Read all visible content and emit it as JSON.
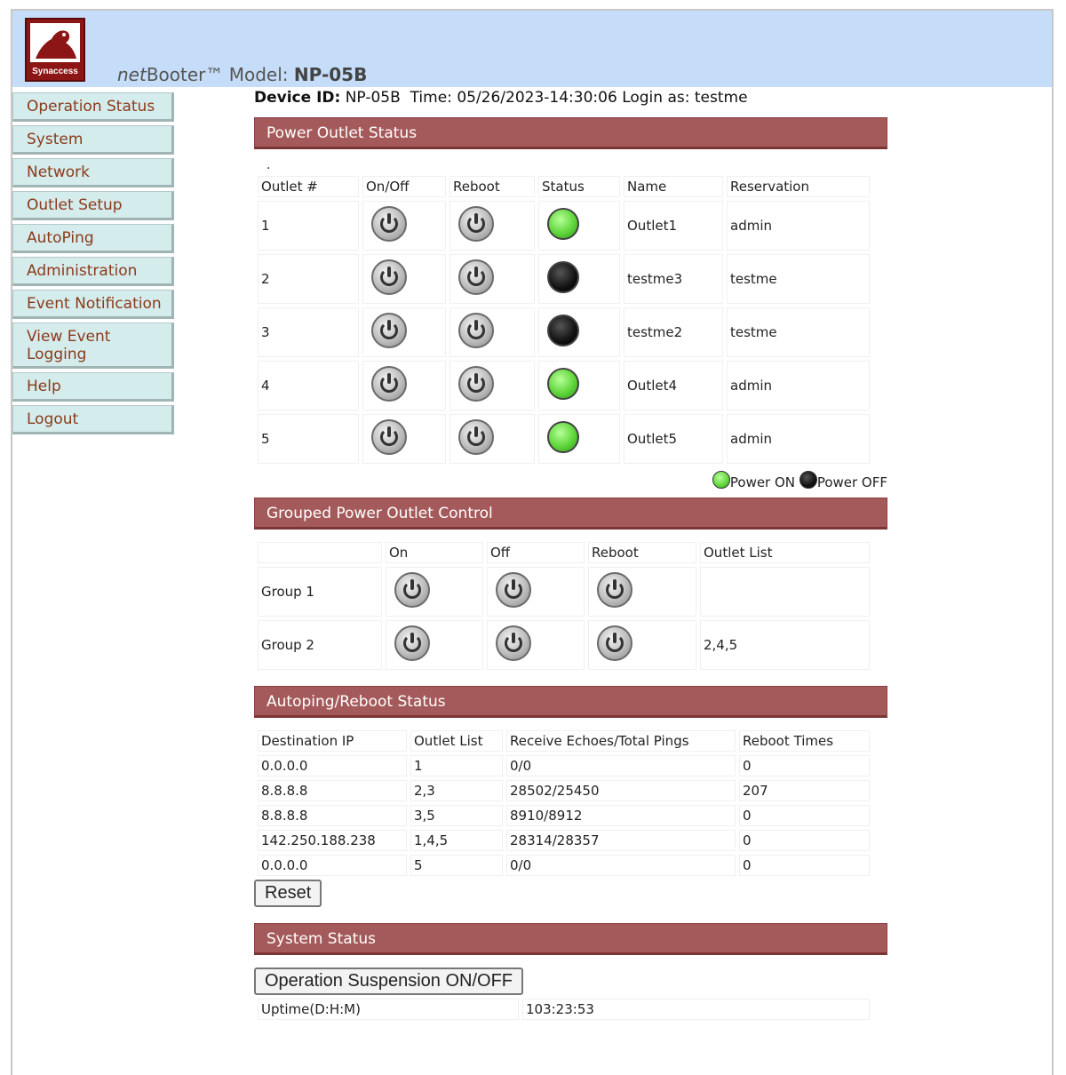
{
  "header": {
    "logo_text": "Synaccess",
    "model_prefix": "net",
    "model_brand": "Booter™ Model: ",
    "model_name": "NP-05B"
  },
  "nav": {
    "items": [
      {
        "label": "Operation Status"
      },
      {
        "label": "System"
      },
      {
        "label": "Network"
      },
      {
        "label": "Outlet Setup"
      },
      {
        "label": "AutoPing"
      },
      {
        "label": "Administration"
      },
      {
        "label": "Event Notification"
      },
      {
        "label": "View Event Logging"
      },
      {
        "label": "Help"
      },
      {
        "label": "Logout"
      }
    ]
  },
  "device": {
    "id_label": "Device ID:",
    "id_value": "NP-05B",
    "time_label": "Time:",
    "time_value": "05/26/2023-14:30:06",
    "login_text": "Login as: testme"
  },
  "power_status": {
    "title": "Power Outlet Status",
    "dot": ".",
    "headers": [
      "Outlet #",
      "On/Off",
      "Reboot",
      "Status",
      "Name",
      "Reservation"
    ],
    "rows": [
      {
        "num": "1",
        "status": "on",
        "name": "Outlet1",
        "reservation": "admin"
      },
      {
        "num": "2",
        "status": "off",
        "name": "testme3",
        "reservation": "testme"
      },
      {
        "num": "3",
        "status": "off",
        "name": "testme2",
        "reservation": "testme"
      },
      {
        "num": "4",
        "status": "on",
        "name": "Outlet4",
        "reservation": "admin"
      },
      {
        "num": "5",
        "status": "on",
        "name": "Outlet5",
        "reservation": "admin"
      }
    ],
    "legend_on": "Power ON",
    "legend_off": "Power OFF",
    "color_on": "#5fd63a",
    "color_off": "#111111"
  },
  "grouped": {
    "title": "Grouped Power Outlet Control",
    "headers": [
      "",
      "On",
      "Off",
      "Reboot",
      "Outlet List"
    ],
    "rows": [
      {
        "name": "Group 1",
        "outlets": ""
      },
      {
        "name": "Group 2",
        "outlets": "2,4,5"
      }
    ]
  },
  "autoping": {
    "title": "Autoping/Reboot Status",
    "headers": [
      "Destination IP",
      "Outlet List",
      "Receive Echoes/Total Pings",
      "Reboot Times"
    ],
    "rows": [
      [
        "0.0.0.0",
        "1",
        "0/0",
        "0"
      ],
      [
        "8.8.8.8",
        "2,3",
        "28502/25450",
        "207"
      ],
      [
        "8.8.8.8",
        "3,5",
        "8910/8912",
        "0"
      ],
      [
        "142.250.188.238",
        "1,4,5",
        "28314/28357",
        "0"
      ],
      [
        "0.0.0.0",
        "5",
        "0/0",
        "0"
      ]
    ],
    "reset_label": "Reset"
  },
  "system_status": {
    "title": "System Status",
    "suspension_label": "Operation Suspension ON/OFF",
    "uptime_label": "Uptime(D:H:M)",
    "uptime_value": "103:23:53"
  },
  "colors": {
    "header_bg": "#c5ddf8",
    "section_bar": "#a45a5a",
    "nav_bg": "#d4ecec",
    "nav_text": "#8c3a1a"
  },
  "icons": {
    "power": "power-icon",
    "led": "status-led-icon",
    "logo": "synaccess-logo-icon"
  }
}
